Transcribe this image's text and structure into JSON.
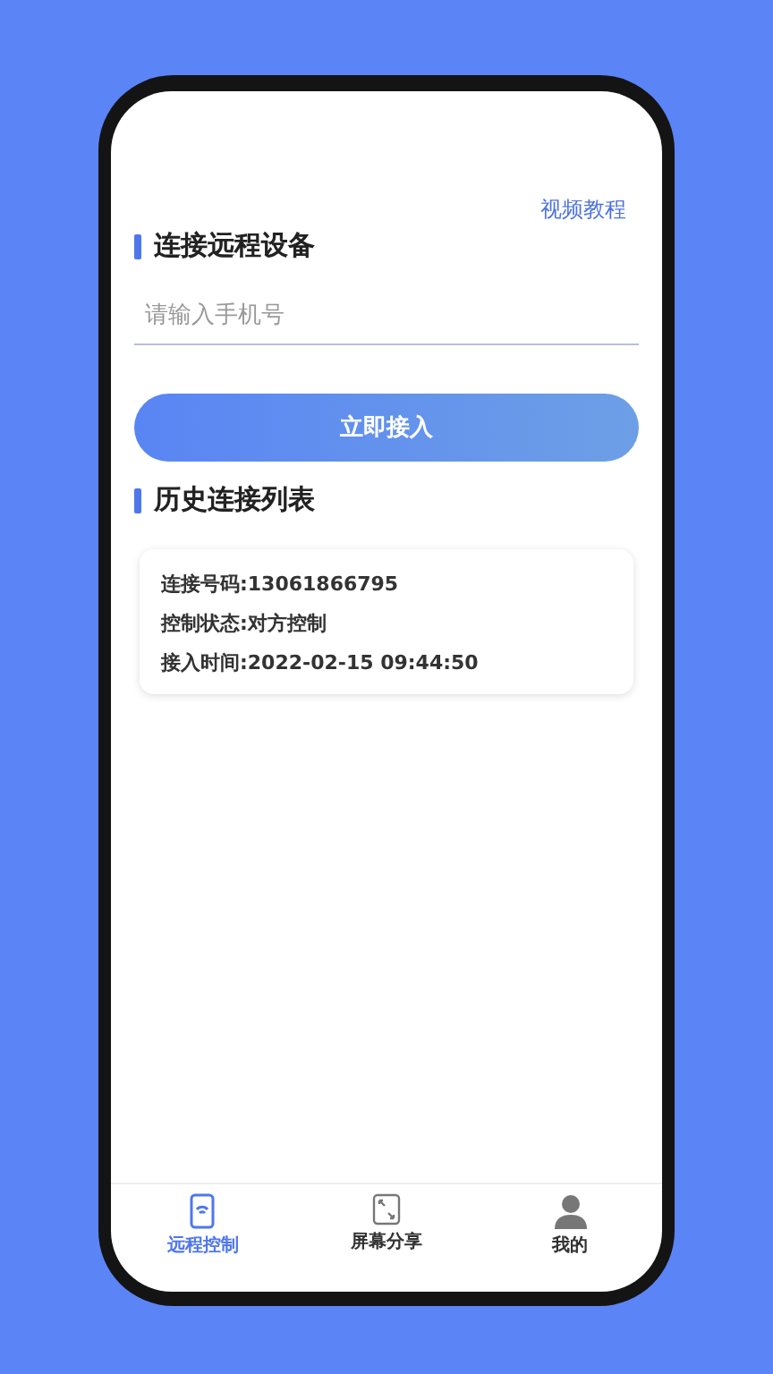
{
  "top_link": "视频教程",
  "connect_section": {
    "title": "连接远程设备",
    "phone_field": {
      "placeholder": "请输入手机号"
    },
    "connect_button": "立即接入"
  },
  "history_section": {
    "title": "历史连接列表",
    "records": [
      {
        "lines": [
          "连接号码:13061866795",
          "控制状态:对方控制",
          "接入时间:2022-02-15 09:44:50"
        ]
      }
    ]
  },
  "tab_bar": [
    {
      "kind": "remote",
      "label": "远程控制",
      "selected": true
    },
    {
      "kind": "share",
      "label": "屏幕分享",
      "selected": false
    },
    {
      "kind": "profile",
      "label": "我的",
      "selected": false
    }
  ]
}
